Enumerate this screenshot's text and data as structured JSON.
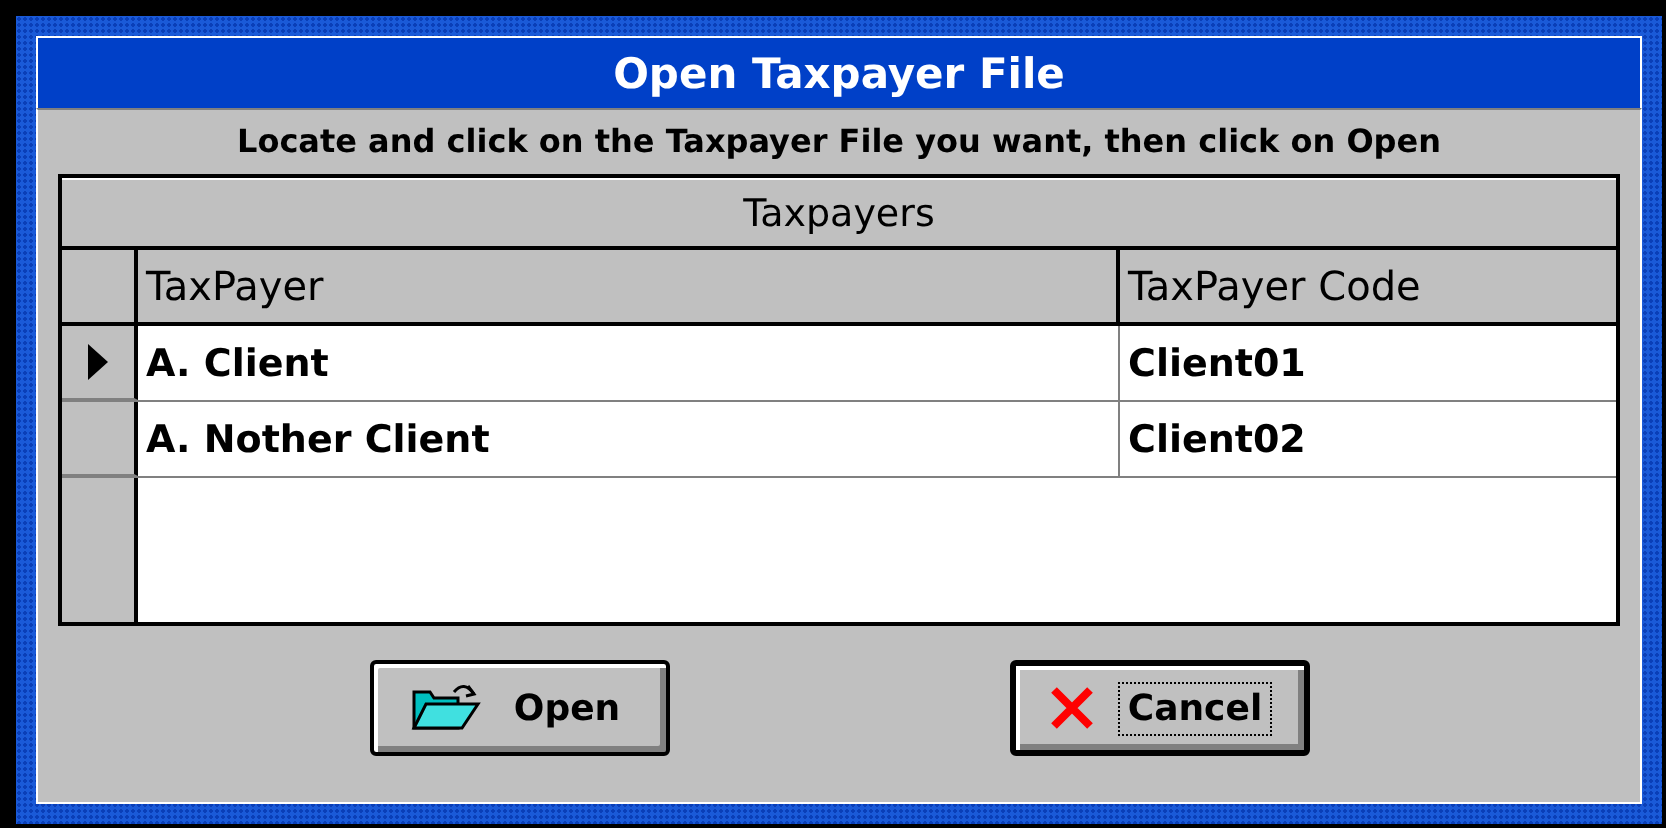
{
  "window": {
    "title": "Open Taxpayer File"
  },
  "instruction": "Locate and click on the Taxpayer File you want, then click on Open",
  "grid": {
    "caption": "Taxpayers",
    "columns": [
      "TaxPayer",
      "TaxPayer Code"
    ],
    "rows": [
      {
        "cells": [
          "A. Client",
          "Client01"
        ],
        "selected": true
      },
      {
        "cells": [
          "A. Nother Client",
          "Client02"
        ],
        "selected": false
      }
    ]
  },
  "buttons": [
    {
      "kind": "open",
      "label": "Open",
      "default": false,
      "focused": false
    },
    {
      "kind": "cancel",
      "label": "Cancel",
      "default": true,
      "focused": true
    }
  ]
}
